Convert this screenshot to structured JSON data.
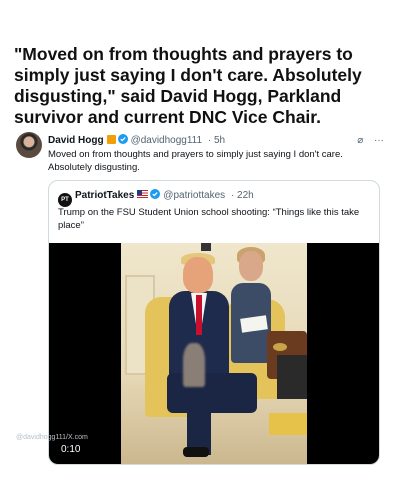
{
  "headline": "\"Moved on from thoughts and prayers to simply just saying I don't care. Absolutely disgusting,\" said David Hogg, Parkland survivor and current DNC Vice Chair.",
  "tweet": {
    "author_name": "David Hogg",
    "handle": "@davidhogg111",
    "time": "· 5h",
    "text": "Moved on from thoughts and prayers to simply just saying I don't care. Absolutely disgusting.",
    "verified_icon": "verified-badge-icon",
    "more_icon": "···",
    "grok_icon": "⌀"
  },
  "quote": {
    "logo_text": "PT",
    "author_name": "PatriotTakes",
    "handle": "@patriottakes",
    "time": "· 22h",
    "text": "Trump on the FSU Student Union school shooting: “Things like this take place”",
    "video_duration": "0:10"
  },
  "watermark": "@davidhogg111/X.com",
  "colors": {
    "verified_blue": "#1d9bf0",
    "text_secondary": "#536471",
    "border": "#cfd9de"
  }
}
